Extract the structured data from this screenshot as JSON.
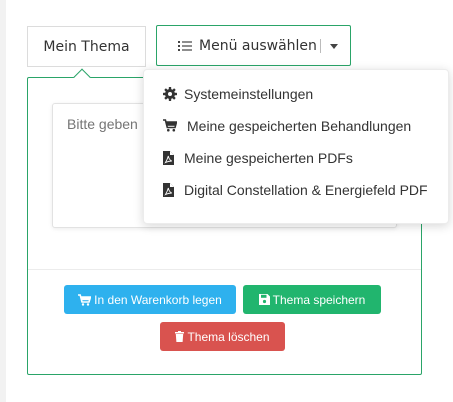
{
  "tab": {
    "label": "Mein Thema"
  },
  "menu_button": {
    "label": "Menü auswählen",
    "icon": "list-icon"
  },
  "editor": {
    "placeholder": "Bitte geben"
  },
  "buttons": {
    "cart": {
      "label": "In den Warenkorb legen",
      "icon": "cart-icon",
      "color": "#2eb1ee"
    },
    "save": {
      "label": "Thema speichern",
      "icon": "save-icon",
      "color": "#21b56e"
    },
    "delete": {
      "label": "Thema löschen",
      "icon": "trash-icon",
      "color": "#d9534f"
    }
  },
  "dropdown": {
    "items": [
      {
        "label": "Systemeinstellungen",
        "icon": "gear-icon"
      },
      {
        "label": "Meine gespeicherten Behandlungen",
        "icon": "cart-icon"
      },
      {
        "label": "Meine gespeicherten PDFs",
        "icon": "pdf-icon"
      },
      {
        "label": "Digital Constellation & Energiefeld PDF",
        "icon": "pdf-icon"
      }
    ]
  },
  "colors": {
    "accent": "#2aa468"
  }
}
